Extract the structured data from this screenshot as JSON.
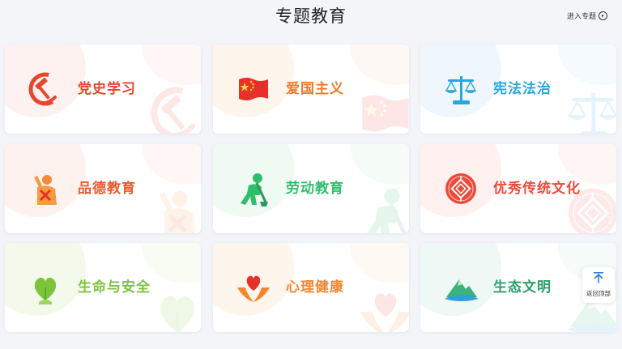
{
  "header": {
    "title": "专题教育",
    "enter_link": "进入专题"
  },
  "topics": [
    {
      "label": "党史学习",
      "icon": "hammer-sickle-icon",
      "color": "#e8452e",
      "tint": "#fde8e6"
    },
    {
      "label": "爱国主义",
      "icon": "china-flag-icon",
      "color": "#f07a2c",
      "tint": "#fdecdf"
    },
    {
      "label": "宪法法治",
      "icon": "scales-icon",
      "color": "#27a6e0",
      "tint": "#e2f1fb"
    },
    {
      "label": "品德教育",
      "icon": "saluting-person-icon",
      "color": "#ef5a2e",
      "tint": "#fde8e1"
    },
    {
      "label": "劳动教育",
      "icon": "worker-digging-icon",
      "color": "#2fbf6c",
      "tint": "#e1f6ea"
    },
    {
      "label": "优秀传统文化",
      "icon": "chinese-knot-icon",
      "color": "#ee4a3a",
      "tint": "#fde6e3"
    },
    {
      "label": "生命与安全",
      "icon": "heart-plant-icon",
      "color": "#7cc43a",
      "tint": "#eaf6dd"
    },
    {
      "label": "心理健康",
      "icon": "heart-hands-icon",
      "color": "#f5862e",
      "tint": "#fdeede"
    },
    {
      "label": "生态文明",
      "icon": "green-mountain-icon",
      "color": "#2e9f6a",
      "tint": "#e0f3ec"
    }
  ],
  "back_to_top": {
    "label": "返回顶部",
    "icon": "arrow-up-icon",
    "color": "#2e7fe0"
  }
}
